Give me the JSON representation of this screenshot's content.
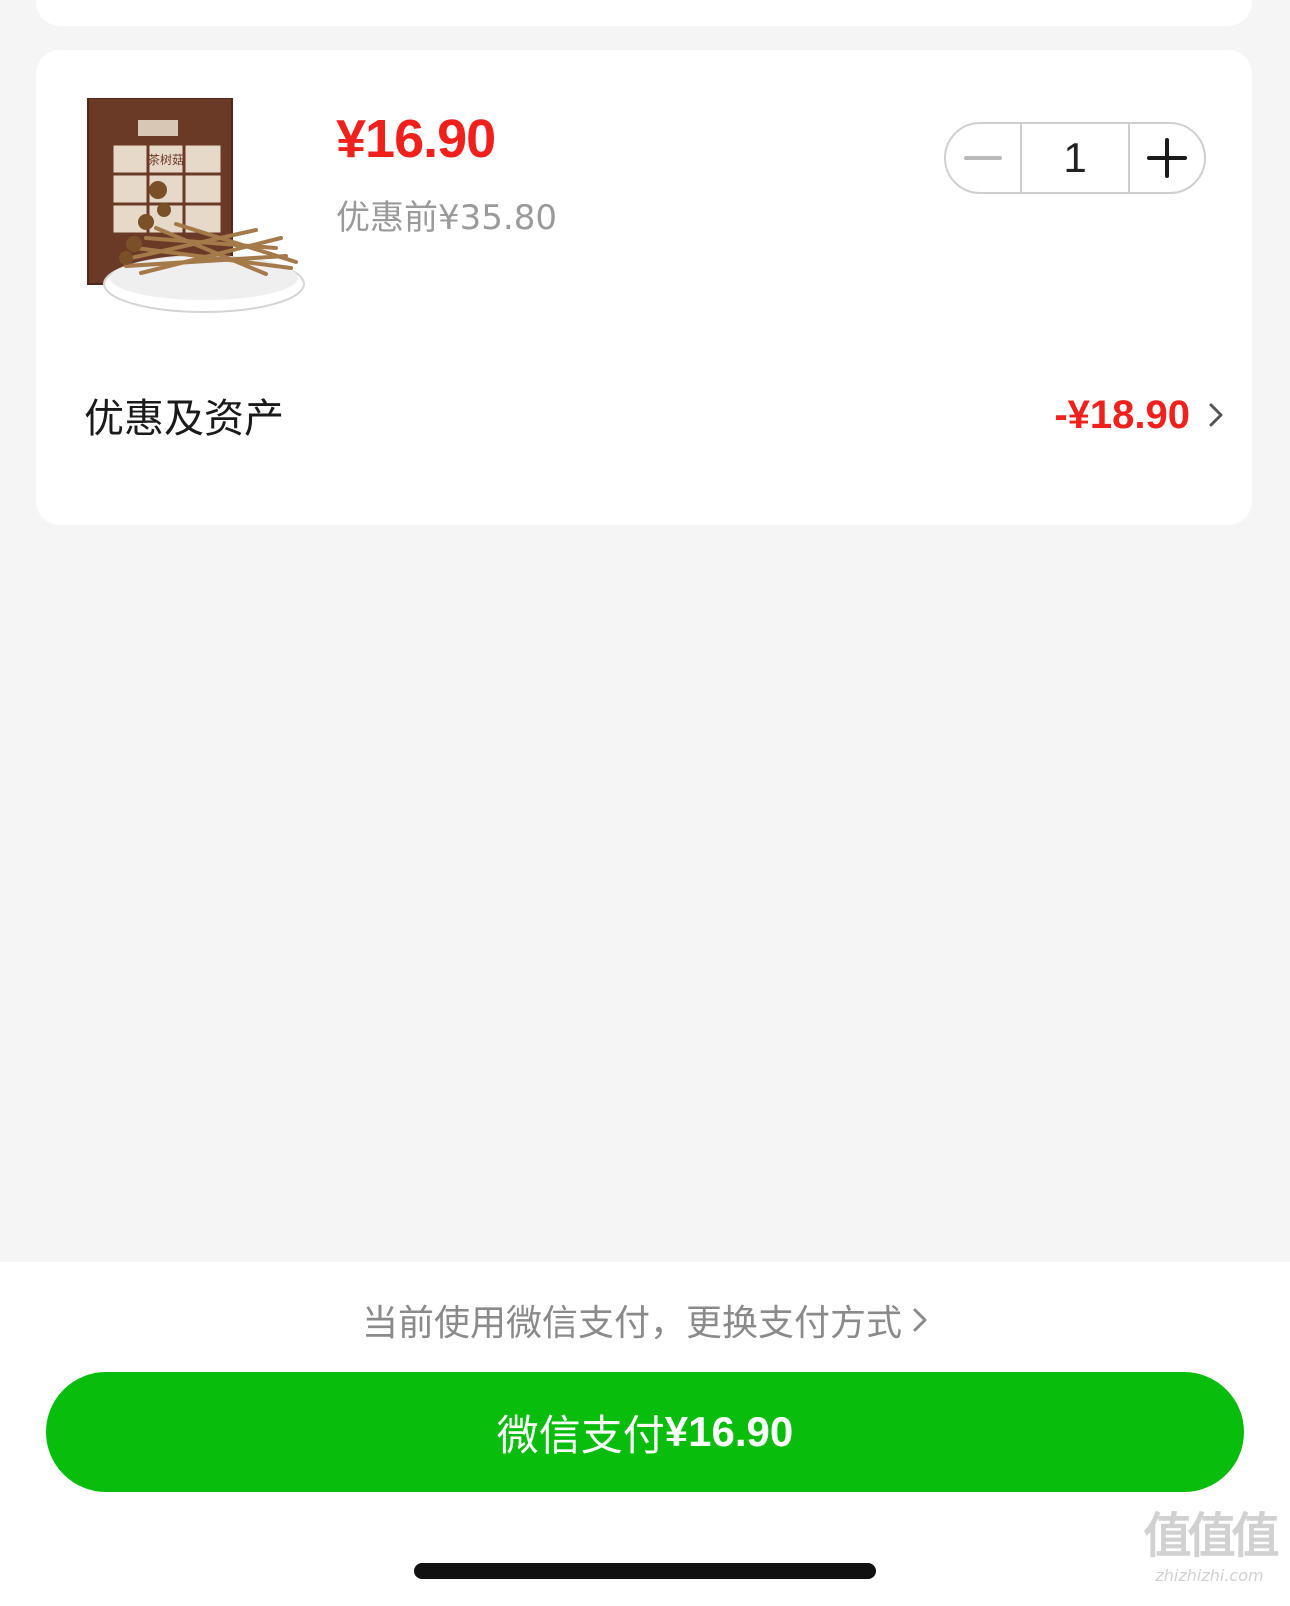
{
  "order": {
    "price_now": "¥16.90",
    "price_before": "优惠前¥35.80",
    "quantity": "1",
    "discount_label": "优惠及资产",
    "discount_value": "-¥18.90",
    "product_image": {
      "description": "brown package of dried tea-tree mushrooms on white dish",
      "package_text": "茶树菇"
    }
  },
  "footer": {
    "pay_switch_text": "当前使用微信支付，更换支付方式",
    "pay_button_prefix": "微信支付",
    "pay_button_amount": "¥16.90"
  },
  "watermark": {
    "glyphs": "值值值",
    "site": "zhizhizhi.com"
  },
  "colors": {
    "accent_red": "#f0211c",
    "wechat_green": "#08bd0c",
    "background": "#f5f5f5",
    "secondary_text": "#9a9a9a"
  },
  "icons": [
    "minus-icon",
    "plus-icon",
    "chevron-right-icon"
  ]
}
